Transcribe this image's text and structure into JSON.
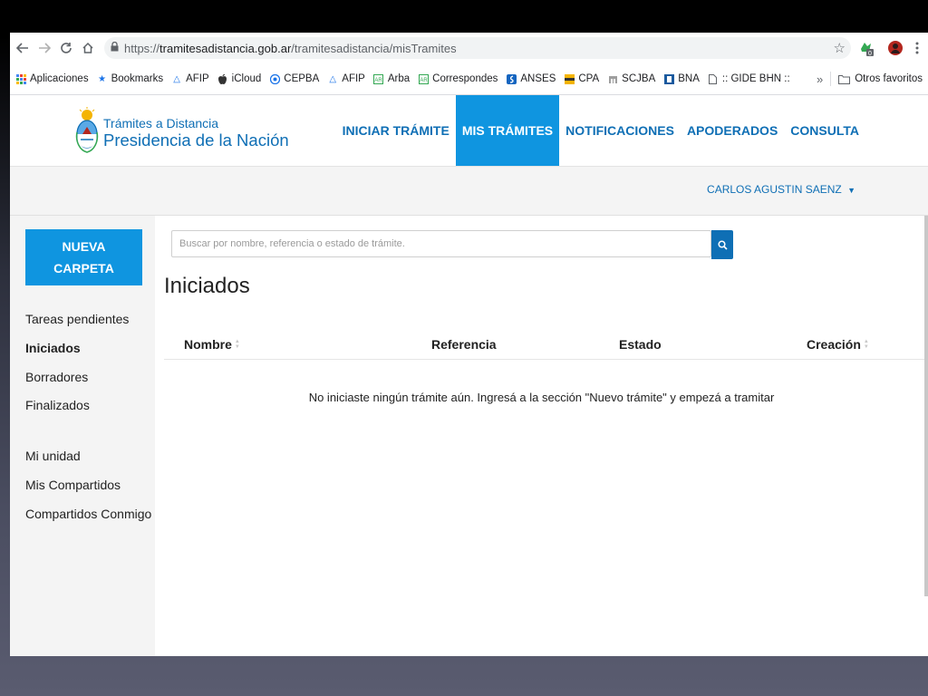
{
  "browser": {
    "url": {
      "scheme": "https://",
      "host": "tramitesadistancia.gob.ar",
      "path": "/tramitesadistancia/misTramites"
    },
    "extension_badge": "0",
    "bookmarks": [
      {
        "icon": "apps-grid-icon",
        "label": "Aplicaciones"
      },
      {
        "icon": "star-icon",
        "label": "Bookmarks"
      },
      {
        "icon": "afip-icon",
        "label": "AFIP"
      },
      {
        "icon": "apple-icon",
        "label": "iCloud"
      },
      {
        "icon": "cepba-icon",
        "label": "CEPBA"
      },
      {
        "icon": "afip-icon",
        "label": "AFIP"
      },
      {
        "icon": "arba-icon",
        "label": "Arba"
      },
      {
        "icon": "arba-icon",
        "label": "Correspondes"
      },
      {
        "icon": "anses-icon",
        "label": "ANSES"
      },
      {
        "icon": "cpa-icon",
        "label": "CPA"
      },
      {
        "icon": "scjba-icon",
        "label": "SCJBA"
      },
      {
        "icon": "bna-icon",
        "label": "BNA"
      },
      {
        "icon": "page-icon",
        "label": ":: GIDE BHN ::"
      }
    ],
    "bookmarks_overflow": "»",
    "other_bookmarks": "Otros favoritos"
  },
  "site": {
    "brand_line1": "Trámites a Distancia",
    "brand_line2": "Presidencia de la Nación",
    "nav": [
      {
        "label": "INICIAR TRÁMITE",
        "active": false
      },
      {
        "label": "MIS TRÁMITES",
        "active": true
      },
      {
        "label": "NOTIFICACIONES",
        "active": false
      },
      {
        "label": "APODERADOS",
        "active": false
      },
      {
        "label": "CONSULTA",
        "active": false
      }
    ],
    "user_name": "CARLOS AGUSTIN SAENZ"
  },
  "sidebar": {
    "new_folder_line1": "NUEVA",
    "new_folder_line2": "CARPETA",
    "items": [
      {
        "label": "Tareas pendientes",
        "active": false
      },
      {
        "label": "Iniciados",
        "active": true
      },
      {
        "label": "Borradores",
        "active": false
      },
      {
        "label": "Finalizados",
        "active": false
      }
    ],
    "items2": [
      {
        "label": "Mi unidad"
      },
      {
        "label": "Mis Compartidos"
      },
      {
        "label": "Compartidos Conmigo"
      }
    ]
  },
  "main": {
    "search_placeholder": "Buscar por nombre, referencia o estado de trámite.",
    "title": "Iniciados",
    "columns": [
      "Nombre",
      "Referencia",
      "Estado",
      "Creación"
    ],
    "empty_message": "No iniciaste ningún trámite aún. Ingresá a la sección \"Nuevo trámite\" y empezá a tramitar"
  },
  "colors": {
    "brand_blue": "#0f6fb5",
    "active_blue": "#0f95e0"
  }
}
